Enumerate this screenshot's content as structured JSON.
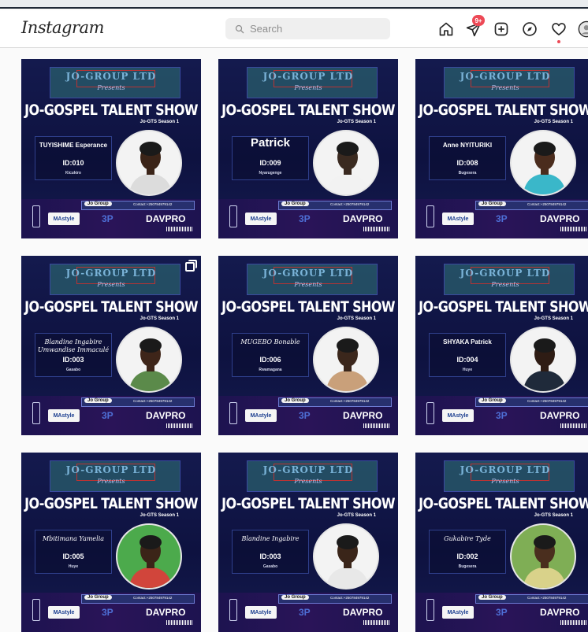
{
  "app": {
    "logo": "Instagram"
  },
  "search": {
    "placeholder": "Search"
  },
  "nav": {
    "icons": [
      "home-icon",
      "messenger-icon",
      "new-post-icon",
      "explore-icon",
      "activity-heart-icon",
      "profile-avatar"
    ],
    "messages_badge": "9+"
  },
  "posts": [
    {
      "brand": "JO-GROUP LTD",
      "presents": "Presents",
      "title": "JO-GOSPEL TALENT SHOW",
      "season": "Jo-GTS Season 1",
      "name": "TUYISHIME Esperance",
      "name_style": "normal",
      "id": "ID:010",
      "from": "Kicukiro",
      "skin": "#3b2418",
      "shirt": "#dcdcdc"
    },
    {
      "brand": "JO-GROUP LTD",
      "presents": "Presents",
      "title": "JO-GOSPEL TALENT SHOW",
      "season": "Jo-GTS Season 1",
      "name": "Patrick",
      "name_style": "big",
      "id": "ID:009",
      "from": "Nyarugenge",
      "skin": "#3a2a20",
      "shirt": "#f2f2f2"
    },
    {
      "brand": "JO-GROUP LTD",
      "presents": "Presents",
      "title": "JO-GOSPEL TALENT SHOW",
      "season": "Jo-GTS Season 1",
      "name": "Anne NYITURIKI",
      "name_style": "normal",
      "id": "ID:008",
      "from": "Bugesera",
      "skin": "#4a2c1d",
      "shirt": "#3ab7c9"
    },
    {
      "brand": "JO-GROUP LTD",
      "presents": "Presents",
      "title": "JO-GOSPEL TALENT SHOW",
      "season": "Jo-GTS Season 1",
      "name": "Blandine Ingabire Umwandise Immaculé",
      "name_style": "script",
      "id": "ID:003",
      "from": "Gasabo",
      "skin": "#3e2519",
      "shirt": "#5b8a4a",
      "multi": true
    },
    {
      "brand": "JO-GROUP LTD",
      "presents": "Presents",
      "title": "JO-GOSPEL TALENT SHOW",
      "season": "Jo-GTS Season 1",
      "name": "MUGEBO Bonable",
      "name_style": "script",
      "id": "ID:006",
      "from": "Rwamagana",
      "skin": "#3b271c",
      "shirt": "#c9a07a"
    },
    {
      "brand": "JO-GROUP LTD",
      "presents": "Presents",
      "title": "JO-GOSPEL TALENT SHOW",
      "season": "Jo-GTS Season 1",
      "name": "SHYAKA Patrick",
      "name_style": "normal",
      "id": "ID:004",
      "from": "Huye",
      "skin": "#2e1c14",
      "shirt": "#1f2a3a"
    },
    {
      "brand": "JO-GROUP LTD",
      "presents": "Presents",
      "title": "JO-GOSPEL TALENT SHOW",
      "season": "Jo-GTS Season 1",
      "name": "Mbitimana Yamelia",
      "name_style": "script",
      "id": "ID:005",
      "from": "Huye",
      "skin": "#3b2418",
      "shirt": "#d1453b",
      "bg": "#4caa4c"
    },
    {
      "brand": "JO-GROUP LTD",
      "presents": "Presents",
      "title": "JO-GOSPEL TALENT SHOW",
      "season": "Jo-GTS Season 1",
      "name": "Blandine Ingabire",
      "name_style": "script",
      "id": "ID:003",
      "from": "Gasabo",
      "skin": "#3a2519",
      "shirt": "#e8e8e8"
    },
    {
      "brand": "JO-GROUP LTD",
      "presents": "Presents",
      "title": "JO-GOSPEL TALENT SHOW",
      "season": "Jo-GTS Season 1",
      "name": "Gukabire Tyde",
      "name_style": "script",
      "id": "ID:002",
      "from": "Bugesera",
      "skin": "#4a2e1e",
      "shirt": "#d9d28a",
      "bg": "#7fae55"
    }
  ],
  "footer": {
    "company": "Jo Group",
    "contact": "Contact:+250784979142",
    "sponsor_left": "MAstyle",
    "sponsor_mid": "3P",
    "sponsor_right": "DAVPRO"
  }
}
